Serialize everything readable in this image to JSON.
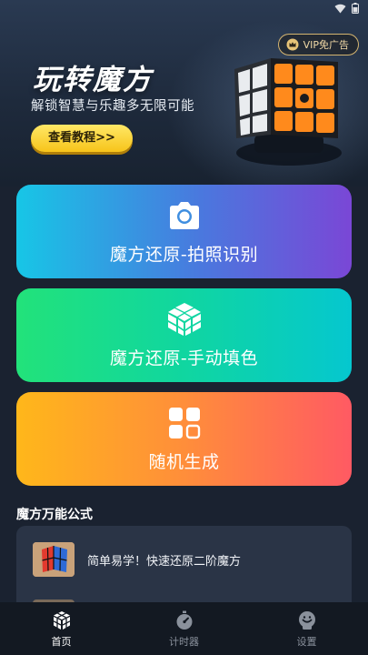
{
  "status_bar": {
    "time": ""
  },
  "hero": {
    "vip_label": "VIP免广告",
    "title": "玩转魔方",
    "subtitle": "解锁智慧与乐趣多无限可能",
    "tutorial_button": "查看教程>>"
  },
  "cards": [
    {
      "label": "魔方还原-拍照识别",
      "icon": "camera-icon"
    },
    {
      "label": "魔方还原-手动填色",
      "icon": "cube-icon"
    },
    {
      "label": "随机生成",
      "icon": "grid-icon"
    }
  ],
  "formulas": {
    "title": "魔方万能公式",
    "items": [
      {
        "text": "简单易学！快速还原二阶魔方"
      },
      {
        "text": ""
      }
    ]
  },
  "tabbar": {
    "items": [
      {
        "label": "首页",
        "icon": "cube-icon",
        "active": true
      },
      {
        "label": "计时器",
        "icon": "stopwatch-icon",
        "active": false
      },
      {
        "label": "设置",
        "icon": "settings-icon",
        "active": false
      }
    ]
  },
  "colors": {
    "vip_border": "#e8c478",
    "tutorial_button": "#f7c41a",
    "tab_active": "#ffffff",
    "tab_inactive": "#8a919c"
  }
}
